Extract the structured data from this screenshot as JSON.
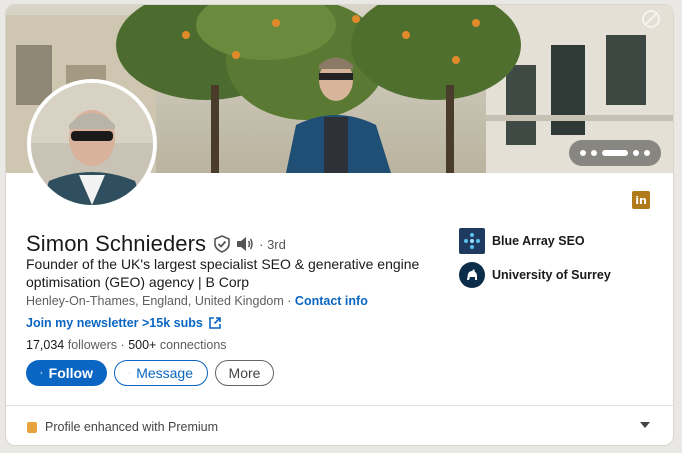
{
  "profile": {
    "name": "Simon Schnieders",
    "degree": "· 3rd",
    "headline": "Founder of the UK's largest specialist SEO & generative engine optimisation (GEO) agency | B Corp",
    "location": "Henley-On-Thames, England, United Kingdom",
    "separator": "·",
    "contact_info": "Contact info",
    "newsletter": "Join my newsletter >15k subs",
    "followers_count": "17,034",
    "followers_label": "followers",
    "stats_separator": "·",
    "connections_count": "500+",
    "connections_label": "connections"
  },
  "actions": {
    "follow": "Follow",
    "message": "Message",
    "more": "More"
  },
  "organizations": [
    {
      "name": "Blue Array SEO",
      "icon": "blue-array-logo"
    },
    {
      "name": "University of Surrey",
      "icon": "university-of-surrey-logo"
    }
  ],
  "premium": {
    "label": "Profile enhanced with Premium"
  },
  "linkedin_badge": {
    "text": "in"
  },
  "colors": {
    "accent": "#0a66c2",
    "premium_gold": "#e7a33e",
    "badge": "#b07a1d"
  }
}
